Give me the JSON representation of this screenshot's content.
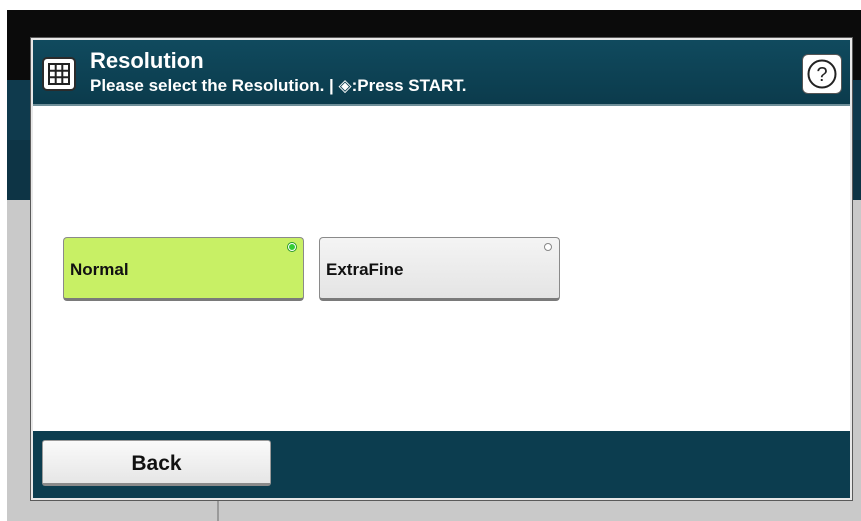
{
  "dialog": {
    "title": "Resolution",
    "subtitle": "Please select the Resolution. | ◈:Press START.",
    "title_icon": "grid-icon",
    "help_icon": "question-icon",
    "help_label": "?"
  },
  "options": [
    {
      "label": "Normal",
      "selected": true
    },
    {
      "label": "ExtraFine",
      "selected": false
    }
  ],
  "footer": {
    "back_label": "Back"
  },
  "colors": {
    "titlebar": "#0b3b4c",
    "selected_option": "#c8f065",
    "selected_indicator": "#33cc33",
    "unselected_option": "#e8e8e8"
  }
}
